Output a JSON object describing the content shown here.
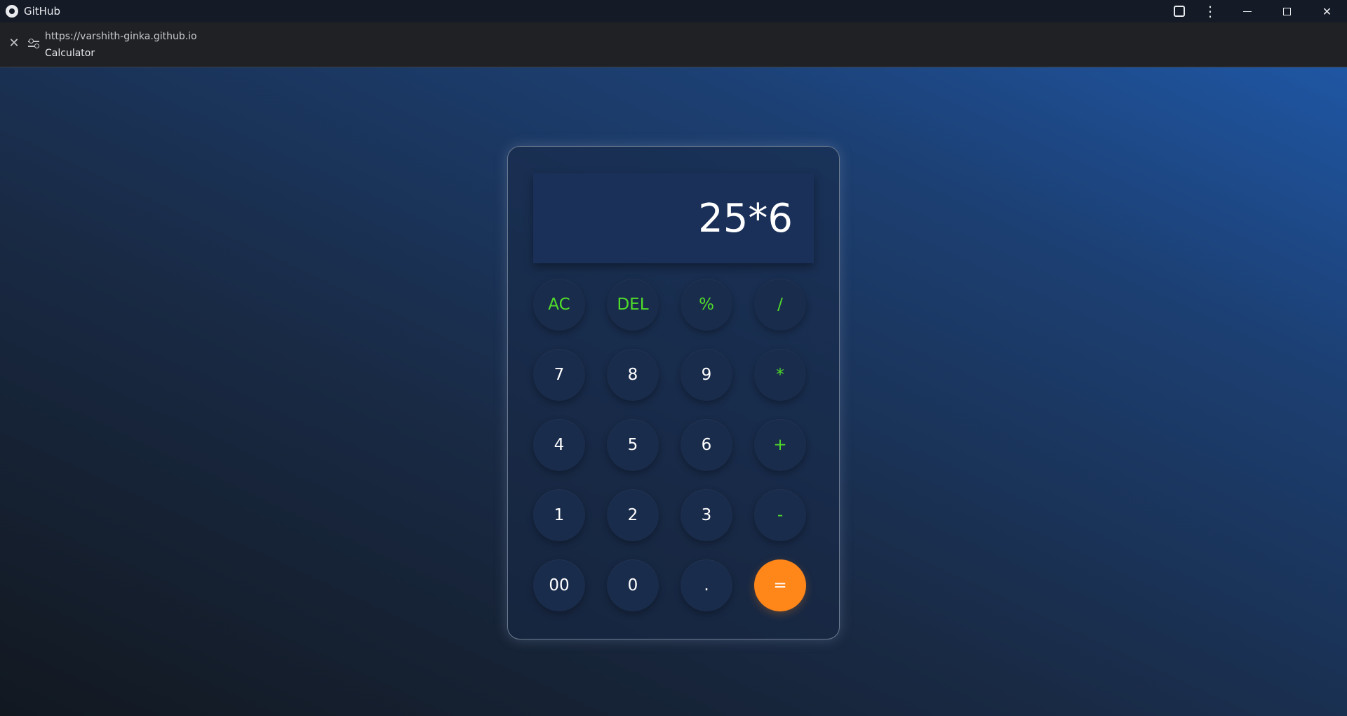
{
  "window": {
    "title": "GitHub",
    "icons": {
      "app": "github-logo-icon",
      "extension": "puzzle-extension-icon",
      "menu": "more-vertical-icon",
      "minimize": "minimize-icon",
      "restore": "restore-icon",
      "close": "close-icon"
    }
  },
  "address": {
    "url": "https://varshith-ginka.github.io",
    "title": "Calculator"
  },
  "colors": {
    "accent_operator": "#4fdc2a",
    "equals": "#ff8619",
    "display_bg": "#1a3058"
  },
  "calculator": {
    "display": "25*6",
    "keys": [
      {
        "label": "AC",
        "type": "op"
      },
      {
        "label": "DEL",
        "type": "op"
      },
      {
        "label": "%",
        "type": "op"
      },
      {
        "label": "/",
        "type": "op"
      },
      {
        "label": "7",
        "type": "num"
      },
      {
        "label": "8",
        "type": "num"
      },
      {
        "label": "9",
        "type": "num"
      },
      {
        "label": "*",
        "type": "op"
      },
      {
        "label": "4",
        "type": "num"
      },
      {
        "label": "5",
        "type": "num"
      },
      {
        "label": "6",
        "type": "num"
      },
      {
        "label": "+",
        "type": "op"
      },
      {
        "label": "1",
        "type": "num"
      },
      {
        "label": "2",
        "type": "num"
      },
      {
        "label": "3",
        "type": "num"
      },
      {
        "label": "-",
        "type": "op"
      },
      {
        "label": "00",
        "type": "num"
      },
      {
        "label": "0",
        "type": "num"
      },
      {
        "label": ".",
        "type": "num"
      },
      {
        "label": "=",
        "type": "eq"
      }
    ]
  }
}
